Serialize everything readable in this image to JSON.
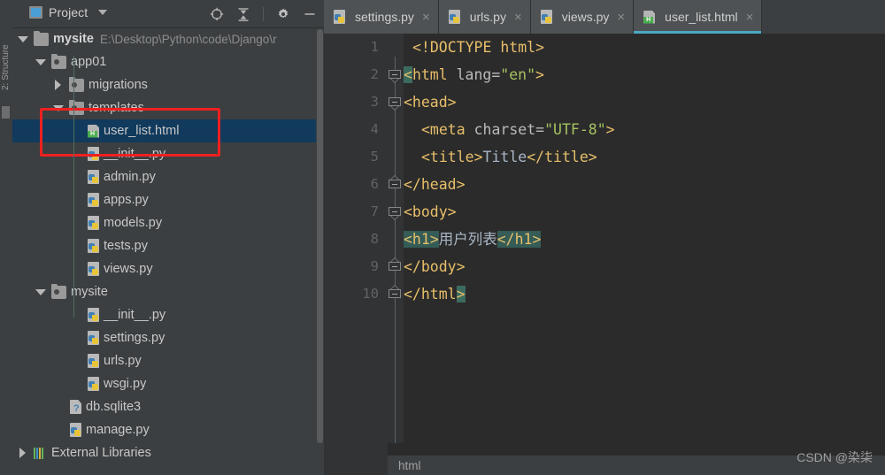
{
  "window": {
    "left_strip_label": "2: Structure"
  },
  "project_panel": {
    "title": "Project",
    "dropdown_icon": "chevron-down-icon",
    "tools": [
      {
        "name": "locate-icon",
        "label": ""
      },
      {
        "name": "collapse-all-icon",
        "label": ""
      },
      {
        "name": "gear-icon",
        "label": ""
      },
      {
        "name": "minimize-icon",
        "label": ""
      }
    ],
    "tree": [
      {
        "label": "mysite",
        "path": "E:\\Desktop\\Python\\code\\Django\\r",
        "icon": "folder-icon",
        "arrow": "open",
        "indent": 0,
        "bold": true,
        "selected": false
      },
      {
        "label": "app01",
        "path": "",
        "icon": "source-folder-icon",
        "arrow": "open",
        "indent": 1,
        "bold": false,
        "selected": false
      },
      {
        "label": "migrations",
        "path": "",
        "icon": "source-folder-icon",
        "arrow": "closed",
        "indent": 2,
        "bold": false,
        "selected": false
      },
      {
        "label": "templates",
        "path": "",
        "icon": "source-folder-icon",
        "arrow": "open",
        "indent": 2,
        "bold": false,
        "selected": false
      },
      {
        "label": "user_list.html",
        "path": "",
        "icon": "html-file-icon",
        "arrow": "none",
        "indent": 3,
        "bold": false,
        "selected": true
      },
      {
        "label": "__init__.py",
        "path": "",
        "icon": "python-file-icon",
        "arrow": "none",
        "indent": 3,
        "bold": false,
        "selected": false
      },
      {
        "label": "admin.py",
        "path": "",
        "icon": "python-file-icon",
        "arrow": "none",
        "indent": 3,
        "bold": false,
        "selected": false
      },
      {
        "label": "apps.py",
        "path": "",
        "icon": "python-file-icon",
        "arrow": "none",
        "indent": 3,
        "bold": false,
        "selected": false
      },
      {
        "label": "models.py",
        "path": "",
        "icon": "python-file-icon",
        "arrow": "none",
        "indent": 3,
        "bold": false,
        "selected": false
      },
      {
        "label": "tests.py",
        "path": "",
        "icon": "python-file-icon",
        "arrow": "none",
        "indent": 3,
        "bold": false,
        "selected": false
      },
      {
        "label": "views.py",
        "path": "",
        "icon": "python-file-icon",
        "arrow": "none",
        "indent": 3,
        "bold": false,
        "selected": false
      },
      {
        "label": "mysite",
        "path": "",
        "icon": "source-folder-icon",
        "arrow": "open",
        "indent": 1,
        "bold": false,
        "selected": false
      },
      {
        "label": "__init__.py",
        "path": "",
        "icon": "python-file-icon",
        "arrow": "none",
        "indent": 3,
        "bold": false,
        "selected": false
      },
      {
        "label": "settings.py",
        "path": "",
        "icon": "python-file-icon",
        "arrow": "none",
        "indent": 3,
        "bold": false,
        "selected": false
      },
      {
        "label": "urls.py",
        "path": "",
        "icon": "python-file-icon",
        "arrow": "none",
        "indent": 3,
        "bold": false,
        "selected": false
      },
      {
        "label": "wsgi.py",
        "path": "",
        "icon": "python-file-icon",
        "arrow": "none",
        "indent": 3,
        "bold": false,
        "selected": false
      },
      {
        "label": "db.sqlite3",
        "path": "",
        "icon": "db-file-icon",
        "arrow": "none",
        "indent": 2,
        "bold": false,
        "selected": false
      },
      {
        "label": "manage.py",
        "path": "",
        "icon": "python-file-icon",
        "arrow": "none",
        "indent": 2,
        "bold": false,
        "selected": false
      },
      {
        "label": "External Libraries",
        "path": "",
        "icon": "library-icon",
        "arrow": "closed",
        "indent": 0,
        "bold": false,
        "selected": false
      }
    ]
  },
  "annotation": {
    "color": "#f02020",
    "target": "templates-and-user-list-html-rows"
  },
  "editor": {
    "tabs": [
      {
        "label": "settings.py",
        "icon": "python-file-icon",
        "active": false,
        "close": "×"
      },
      {
        "label": "urls.py",
        "icon": "python-file-icon",
        "active": false,
        "close": "×"
      },
      {
        "label": "views.py",
        "icon": "python-file-icon",
        "active": false,
        "close": "×"
      },
      {
        "label": "user_list.html",
        "icon": "html-file-icon",
        "active": true,
        "close": "×"
      }
    ],
    "active_tab_accent": "#4aa8c4",
    "line_numbers": [
      "1",
      "2",
      "3",
      "4",
      "5",
      "6",
      "7",
      "8",
      "9",
      "10"
    ],
    "code_lines": [
      {
        "n": "1",
        "indent": 1,
        "parts": [
          {
            "t": "<!DOCTYPE html>",
            "c": "tagb"
          }
        ]
      },
      {
        "n": "2",
        "indent": 0,
        "parts": [
          {
            "t": "<",
            "c": "tagb hl-brace"
          },
          {
            "t": "html ",
            "c": "tagb"
          },
          {
            "t": "lang=",
            "c": "attr"
          },
          {
            "t": "\"en\"",
            "c": "str"
          },
          {
            "t": ">",
            "c": "tagb"
          }
        ]
      },
      {
        "n": "3",
        "indent": 0,
        "parts": [
          {
            "t": "<head>",
            "c": "tagb"
          }
        ]
      },
      {
        "n": "4",
        "indent": 2,
        "parts": [
          {
            "t": "<meta ",
            "c": "tagb"
          },
          {
            "t": "charset=",
            "c": "attr"
          },
          {
            "t": "\"UTF-8\"",
            "c": "str"
          },
          {
            "t": ">",
            "c": "tagb"
          }
        ]
      },
      {
        "n": "5",
        "indent": 2,
        "parts": [
          {
            "t": "<title>",
            "c": "tagb"
          },
          {
            "t": "Title",
            "c": "txt"
          },
          {
            "t": "</title>",
            "c": "tagb"
          }
        ]
      },
      {
        "n": "6",
        "indent": 0,
        "parts": [
          {
            "t": "</head>",
            "c": "tagb"
          }
        ]
      },
      {
        "n": "7",
        "indent": 0,
        "parts": [
          {
            "t": "<body>",
            "c": "tagb"
          }
        ]
      },
      {
        "n": "8",
        "indent": 0,
        "parts": [
          {
            "t": "<h1>",
            "c": "tagb hl-tag"
          },
          {
            "t": "用户列表",
            "c": "txt"
          },
          {
            "t": "</h1>",
            "c": "tagb hl-tag"
          }
        ]
      },
      {
        "n": "9",
        "indent": 0,
        "parts": [
          {
            "t": "</body>",
            "c": "tagb"
          }
        ]
      },
      {
        "n": "10",
        "indent": 0,
        "parts": [
          {
            "t": "</html",
            "c": "tagb"
          },
          {
            "t": ">",
            "c": "tagb hl-brace"
          }
        ]
      }
    ],
    "breadcrumb": "html"
  },
  "watermark": "CSDN @染柒"
}
